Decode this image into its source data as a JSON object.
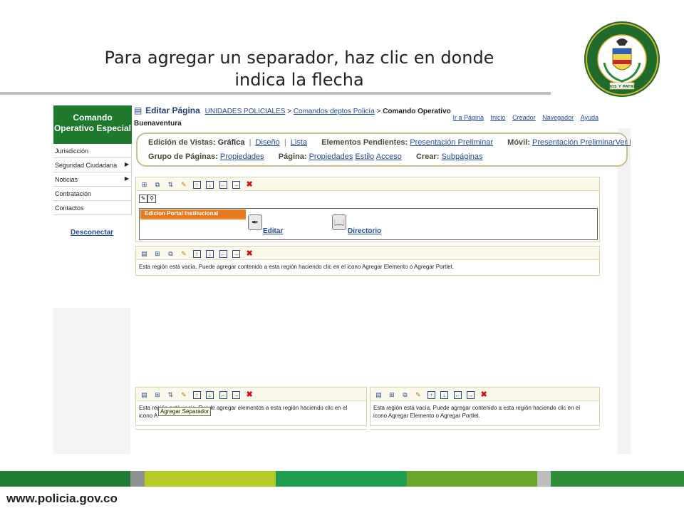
{
  "slide": {
    "title_line1": "Para agregar un separador, haz clic en donde",
    "title_line2": "indica la flecha",
    "footer_url": "www.policia.gov.co"
  },
  "seal": {
    "top_text": "REPÚBLICA DE COLOMBIA",
    "mid_text": "POLICÍA NACIONAL",
    "motto": "DIOS Y PATRIA"
  },
  "sidebar": {
    "header": "Comando Operativo Especial",
    "items": [
      {
        "label": "Jurisdicción",
        "submenu": ""
      },
      {
        "label": "Seguridad Ciudadana",
        "submenu": "▶"
      },
      {
        "label": "Noticias",
        "submenu": "▶"
      },
      {
        "label": "Contratación",
        "submenu": ""
      },
      {
        "label": "Contactos",
        "submenu": ""
      }
    ],
    "logout": "Desconectar"
  },
  "header": {
    "page_title": "Editar Página",
    "crumb1": "UNIDADES POLICIALES",
    "sep": ">",
    "crumb2": "Comandos deptos Policía",
    "crumb3": "Comando Operativo",
    "crumb3_cont": "Buenaventura",
    "links": [
      "Ir a Página",
      "Inicio",
      "Creador",
      "Navegador",
      "Ayuda"
    ]
  },
  "editbar": {
    "views_label": "Edición de Vistas:",
    "views_current": "Gráfica",
    "views_design": "Diseño",
    "views_list": "Lista",
    "pending_label": "Elementos Pendientes:",
    "pending_link": "Presentación Preliminar",
    "mobile_label": "Móvil:",
    "mobile_link": "Presentación PreliminarVer Página",
    "group_label": "Grupo de Páginas:",
    "group_link": "Propiedades",
    "page_label": "Página:",
    "page_props": "Propiedades",
    "page_style": "Estilo",
    "page_access": "Acceso",
    "create_label": "Crear:",
    "create_link": "Subpáginas"
  },
  "portal": {
    "tab": "Edicion Portal Institucional",
    "link1": "Editar",
    "link2": "Directorio"
  },
  "regions": {
    "empty_msg_1": "Esta región está vacía. Puede agregar contenido a esta región haciendo clic en el icono Agregar Elemento o Agregar Portlet.",
    "empty_msg_left_l1": "Esta región está vacía. Puede agregar elementos a esta región haciendo clic en el",
    "empty_msg_left_l2": "icono A",
    "empty_msg_right_l1": "Esta región está vacía. Puede agregar contenido a esta región haciendo clic en el",
    "empty_msg_right_l2": "icono Agregar Elemento o Agregar Portlet.",
    "tooltip": "Agregar Separador"
  },
  "colors": {
    "green_dark": "#1f7a2e",
    "accent_orange": "#e87a1e",
    "link_blue": "#1f4aa0",
    "footer": [
      "#1e7b34",
      "#8f8f8f",
      "#b8c922",
      "#1f9e50",
      "#2a8b3c",
      "#6aa629",
      "#bdbdbd",
      "#2b8c3a"
    ]
  }
}
